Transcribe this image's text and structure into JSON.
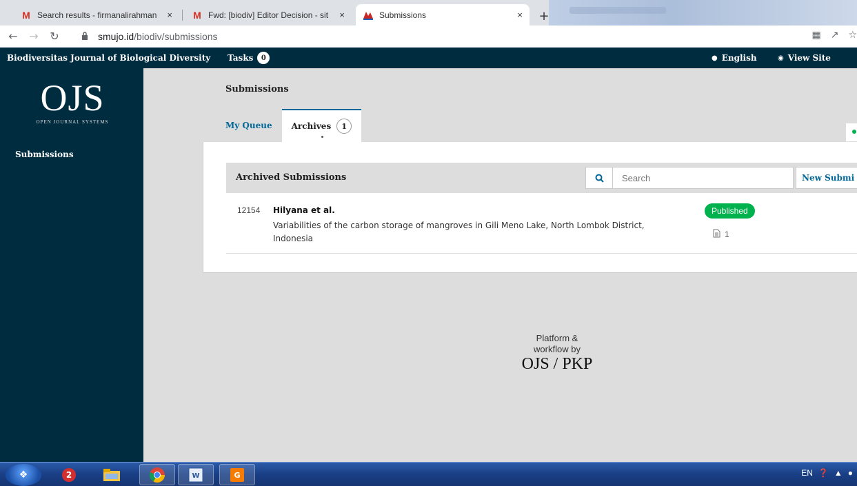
{
  "browser": {
    "tabs": [
      {
        "title": "Search results - firmanalirahman",
        "close": "×"
      },
      {
        "title": "Fwd: [biodiv] Editor Decision - sit",
        "close": "×"
      },
      {
        "title": "Submissions",
        "close": "×"
      }
    ],
    "new_tab": "+",
    "url_host": "smujo.id",
    "url_path": "/biodiv/submissions"
  },
  "header": {
    "site_name": "Biodiversitas Journal of Biological Diversity",
    "tasks_label": "Tasks",
    "tasks_count": "0",
    "language": "English",
    "view_site": "View Site"
  },
  "sidebar": {
    "logo_big": "OJS",
    "logo_small": "OPEN JOURNAL SYSTEMS",
    "nav_submissions": "Submissions"
  },
  "main": {
    "title": "Submissions",
    "tab_queue": "My Queue",
    "tab_archives": "Archives",
    "tab_archives_count": "1"
  },
  "list": {
    "title": "Archived Submissions",
    "search_placeholder": "Search",
    "new_submission": "New Submi",
    "items": [
      {
        "id": "12154",
        "author": "Hilyana et al.",
        "title": "Variabilities of the carbon storage of mangroves in Gili Meno Lake, North Lombok District, Indonesia",
        "status": "Published",
        "files": "1"
      }
    ]
  },
  "footer": {
    "line1": "Platform &",
    "line2": "workflow by",
    "brand": "OJS / PKP"
  },
  "taskbar": {
    "lang": "EN"
  },
  "colors": {
    "ojs_dark": "#002c40",
    "link_blue": "#006798",
    "published_green": "#00b24e"
  }
}
